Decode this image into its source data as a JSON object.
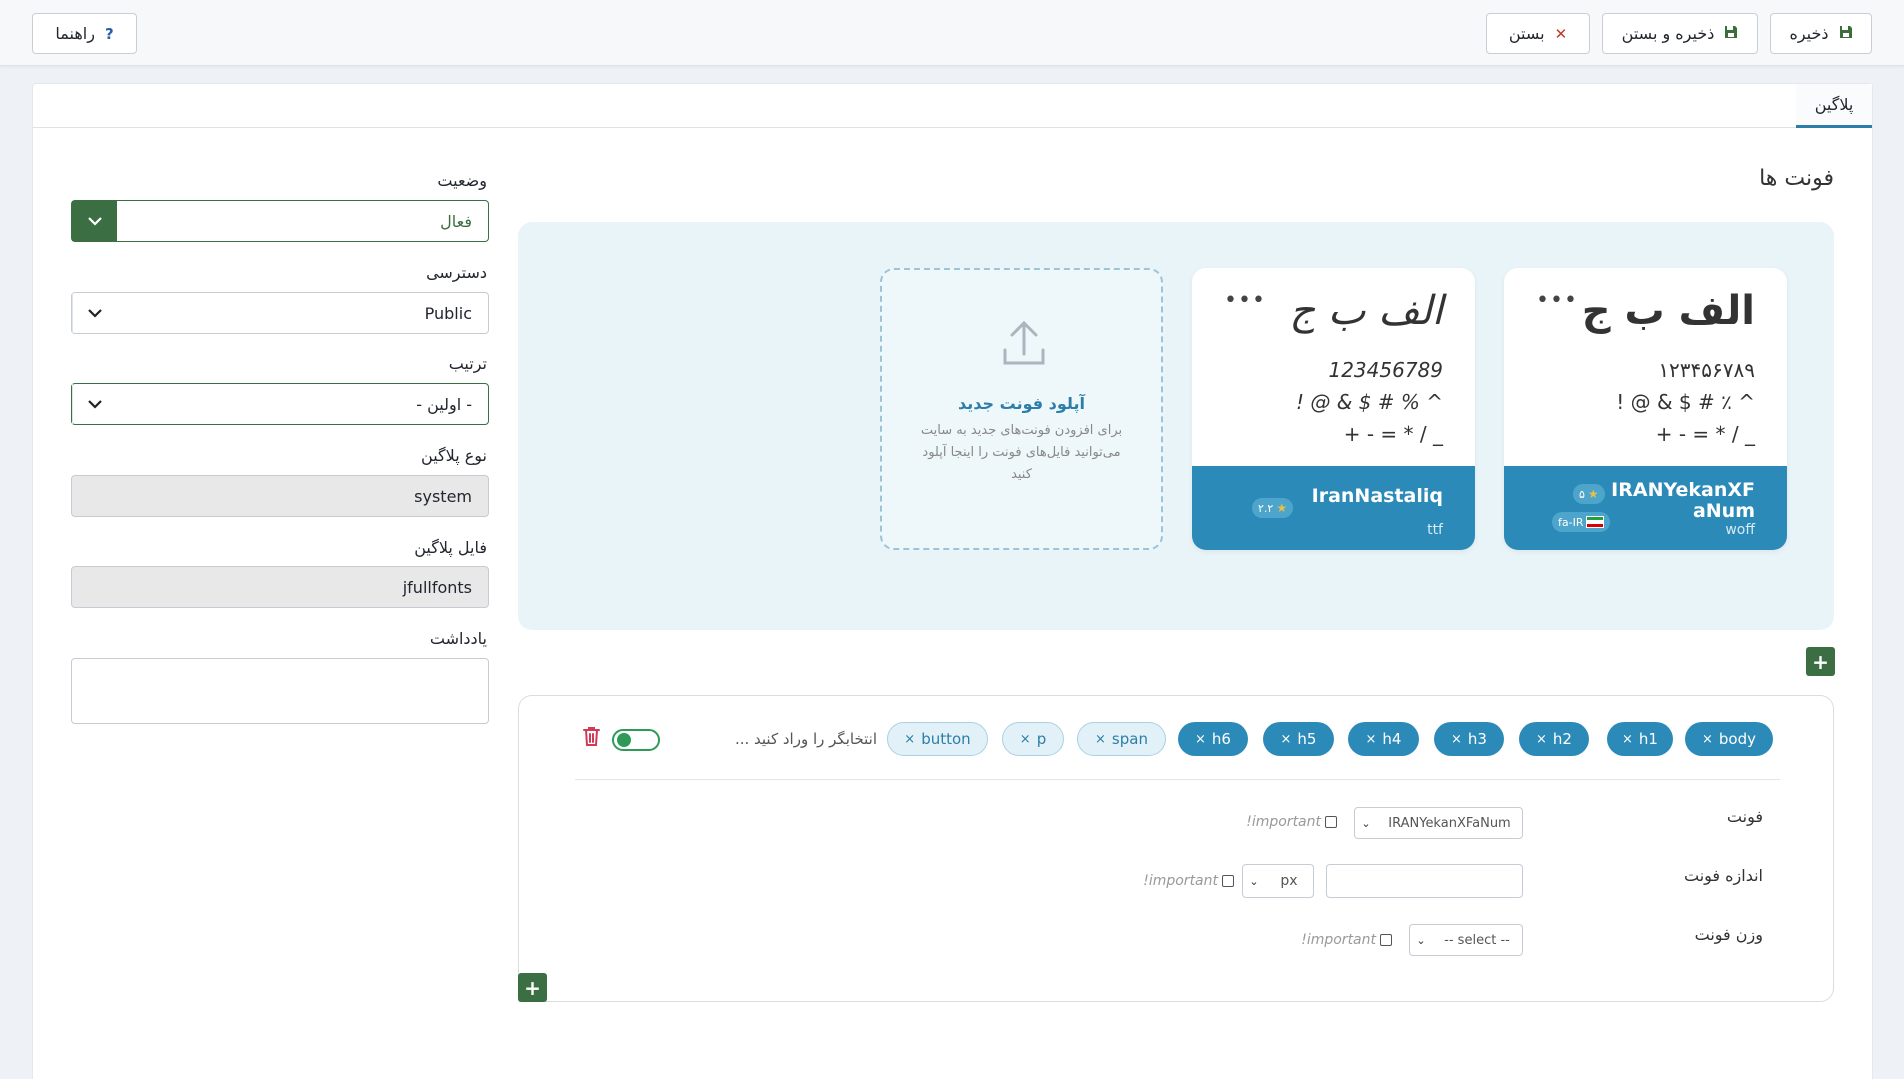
{
  "toolbar": {
    "save_label": "ذخیره",
    "save_close_label": "ذخیره و بستن",
    "close_label": "بستن",
    "help_label": "راهنما"
  },
  "tabs": [
    {
      "label": "پلاگین"
    }
  ],
  "form": {
    "status": {
      "label": "وضعیت",
      "value": "فعال"
    },
    "access": {
      "label": "دسترسی",
      "value": "Public"
    },
    "order": {
      "label": "ترتیب",
      "value": "- اولین -"
    },
    "plugin_type": {
      "label": "نوع پلاگین",
      "value": "system"
    },
    "plugin_file": {
      "label": "فایل پلاگین",
      "value": "jfullfonts"
    },
    "note": {
      "label": "یادداشت",
      "value": ""
    }
  },
  "fonts_section": {
    "title": "فونت ها",
    "cards": [
      {
        "sample_big": "الف ب ج",
        "digits": "۱۲۳۴۵۶۷۸۹",
        "symbols1": "! @ & $ # ٪ ^",
        "symbols2": "+ - = * / _",
        "name": "IRANYekanXFaNum",
        "ext": "woff",
        "rating": "۵",
        "lang": "fa-IR"
      },
      {
        "sample_big": "الف ب ج",
        "digits": "123456789",
        "symbols1": "! @ & $ # % ^",
        "symbols2": "+ - = * / _",
        "name": "IranNastaliq",
        "ext": "ttf",
        "rating": "۲.۲"
      }
    ],
    "upload": {
      "title": "آپلود فونت جدید",
      "desc": "برای افزودن فونت‌های جدید به سایت می‌توانید فایل‌های فونت را اینجا آپلود کنید"
    },
    "add_label": "+"
  },
  "selectors": {
    "chips": [
      {
        "label": "body",
        "style": "dark"
      },
      {
        "label": "h1",
        "style": "dark"
      },
      {
        "label": "h2",
        "style": "dark"
      },
      {
        "label": "h3",
        "style": "dark"
      },
      {
        "label": "h4",
        "style": "dark"
      },
      {
        "label": "h5",
        "style": "dark"
      },
      {
        "label": "h6",
        "style": "dark"
      },
      {
        "label": "span",
        "style": "light"
      },
      {
        "label": "p",
        "style": "light"
      },
      {
        "label": "button",
        "style": "light"
      }
    ],
    "chip_remove": "×",
    "placeholder": "انتخابگر را وراد کنید ...",
    "properties": {
      "font": {
        "label": "فونت",
        "value": "IRANYekanXFaNum"
      },
      "font_size": {
        "label": "اندازه فونت",
        "value": "",
        "unit": "px"
      },
      "font_weight": {
        "label": "وزن فونت",
        "value": "-- select --"
      }
    },
    "important_label": "!important",
    "add_label": "+"
  }
}
